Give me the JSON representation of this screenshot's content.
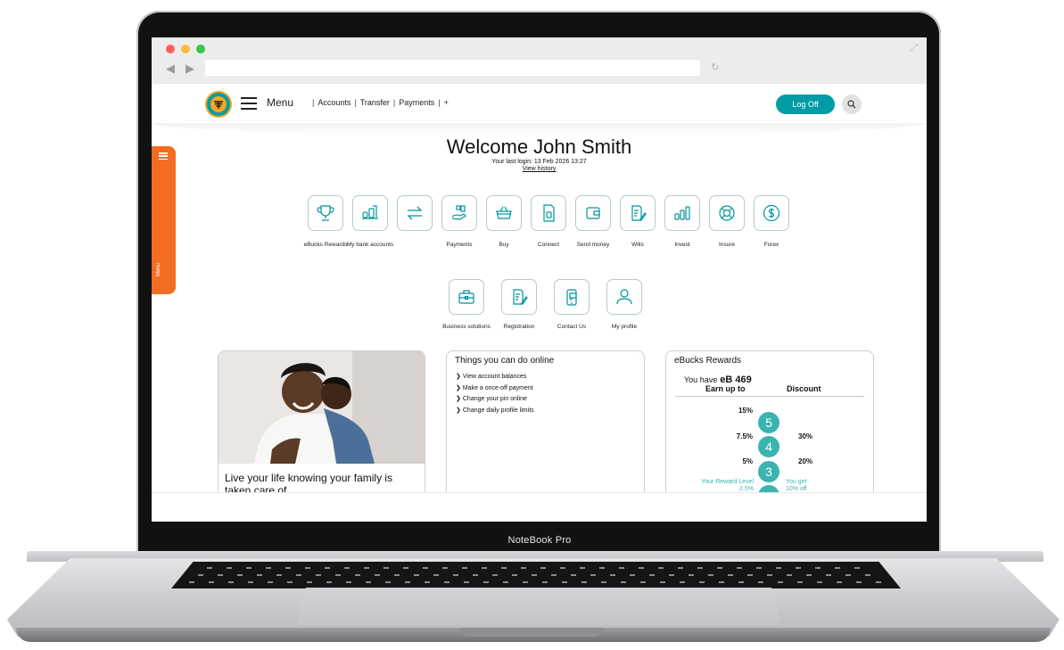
{
  "browser": {
    "url": ""
  },
  "header": {
    "menu_label": "Menu",
    "nav": [
      {
        "label": "Accounts"
      },
      {
        "label": "Transfer"
      },
      {
        "label": "Payments"
      },
      {
        "label": "+"
      }
    ],
    "logoff_label": "Log Off"
  },
  "side_tab": {
    "label": "Menu",
    "color": "#f26d21"
  },
  "welcome": {
    "title": "Welcome John Smith",
    "last_login": "Your last login: 13 Feb 2026 13:27",
    "view_history": "View history"
  },
  "tiles_row1": [
    {
      "label": "eBucks Rewards",
      "icon": "trophy-icon"
    },
    {
      "label": "My bank accounts",
      "icon": "bank-accounts-icon"
    },
    {
      "label": "",
      "icon": "transfer-arrows-icon"
    },
    {
      "label": "Payments",
      "icon": "payments-hand-icon"
    },
    {
      "label": "Buy",
      "icon": "basket-icon"
    },
    {
      "label": "Connect",
      "icon": "sim-card-icon"
    },
    {
      "label": "Send money",
      "icon": "wallet-icon"
    },
    {
      "label": "Wills",
      "icon": "document-pen-icon"
    },
    {
      "label": "Invest",
      "icon": "bar-chart-icon"
    },
    {
      "label": "Insure",
      "icon": "lifebuoy-icon"
    },
    {
      "label": "Forex",
      "icon": "dollar-coin-icon"
    }
  ],
  "tiles_row2": [
    {
      "label": "Business solutions",
      "icon": "briefcase-icon"
    },
    {
      "label": "Registration",
      "icon": "registration-document-icon"
    },
    {
      "label": "Contact Us",
      "icon": "phone-chat-icon"
    },
    {
      "label": "My profile",
      "icon": "user-icon"
    }
  ],
  "promo": {
    "text": "Live your life knowing your family is taken care of"
  },
  "things_online": {
    "title": "Things you can do online",
    "items": [
      "View account balances",
      "Make a once-off payment",
      "Change your pin online",
      "Change daily profile limits"
    ]
  },
  "ebucks": {
    "title": "eBucks Rewards",
    "you_have": "You have",
    "amount": "eB 469",
    "earn_header": "Earn up to",
    "discount_header": "Discount",
    "levels": [
      {
        "level": "5",
        "earn": "15%",
        "discount": ""
      },
      {
        "level": "4",
        "earn": "7.5%",
        "discount": "30%"
      },
      {
        "level": "3",
        "earn": "5%",
        "discount": "20%"
      }
    ],
    "your_level_label": "Your Reward Level",
    "your_level_earn": "2.5%",
    "you_get_label": "You get",
    "you_get_value": "10% off"
  },
  "laptop": {
    "brand": "NoteBook Pro"
  },
  "colors": {
    "brand_teal": "#009ca6",
    "accent_orange": "#f26d21",
    "level_teal": "#3bb4b1"
  }
}
